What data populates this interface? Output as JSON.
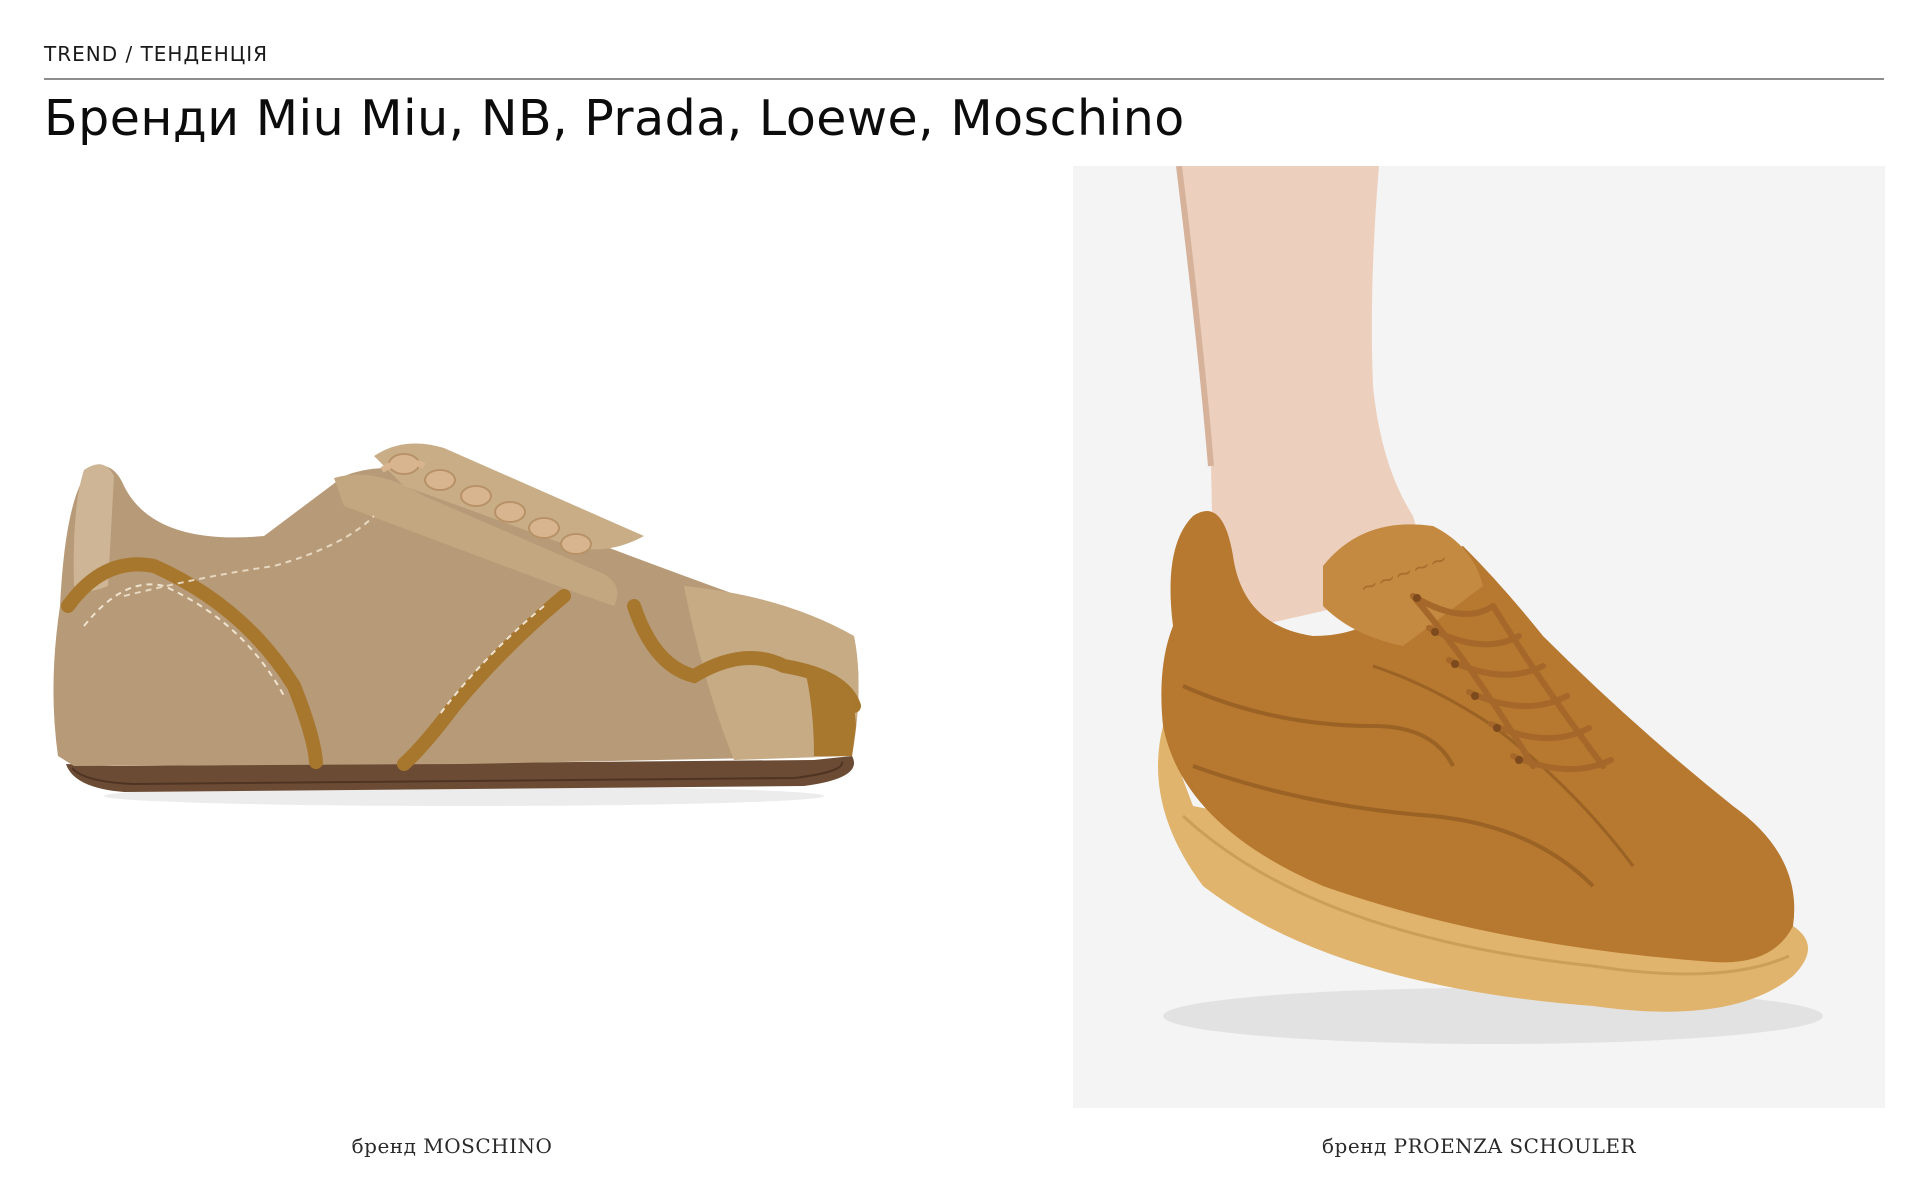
{
  "header": {
    "eyebrow": "TREND / ТЕНДЕНЦІЯ",
    "title": "Бренди Miu Miu, NB, Prada, Loewe, Moschino"
  },
  "figures": [
    {
      "caption": "бренд MOSCHINO",
      "image": "beige-leather-sneaker",
      "colors": {
        "upper": "#b79b78",
        "trim": "#a7772e",
        "sole": "#6b4b34",
        "laces": "#d9b58f"
      }
    },
    {
      "caption": "бренд PROENZA SCHOULER",
      "image": "tan-suede-sneaker-on-foot",
      "colors": {
        "suede": "#b7782f",
        "sole": "#e0b46c",
        "skin": "#ecd0bd",
        "background": "#f4f4f5"
      }
    }
  ]
}
